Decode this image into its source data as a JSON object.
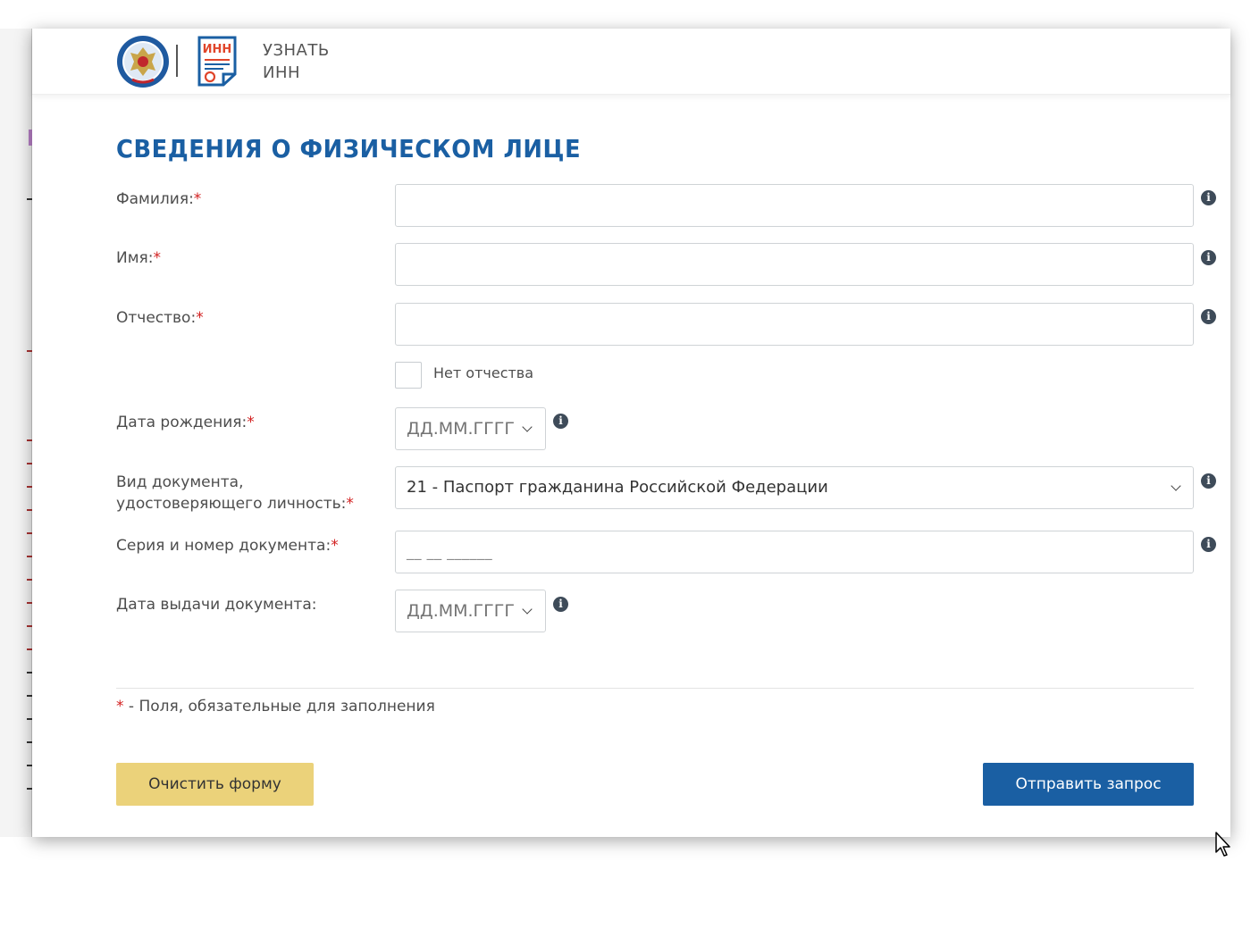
{
  "header": {
    "title_line1": "УЗНАТЬ",
    "title_line2": "ИНН",
    "inn_logo_text": "ИНН",
    "emblem_icon": "fns-emblem-icon",
    "inn_icon": "inn-document-icon"
  },
  "form": {
    "title": "СВЕДЕНИЯ О ФИЗИЧЕСКОМ ЛИЦЕ",
    "required_mark": "*",
    "surname_label": "Фамилия:",
    "surname_value": "",
    "name_label": "Имя:",
    "name_value": "",
    "patronymic_label": "Отчество:",
    "patronymic_value": "",
    "no_patronymic_label": "Нет отчества",
    "no_patronymic_checked": false,
    "birthdate_label": "Дата рождения:",
    "birthdate_placeholder": "ДД.ММ.ГГГГ",
    "doc_type_label_line1": "Вид документа,",
    "doc_type_label_line2": "удостоверяющего личность:",
    "doc_type_value": "21 - Паспорт гражданина Российской Федерации",
    "doc_number_label": "Серия и номер документа:",
    "doc_number_mask": "__ __ ______",
    "issue_date_label": "Дата выдачи документа:",
    "issue_date_placeholder": "ДД.ММ.ГГГГ",
    "info_icon_glyph": "i",
    "footnote_mark": "*",
    "footnote_text": " - Поля, обязательные для заполнения"
  },
  "buttons": {
    "clear_label": "Очистить форму",
    "submit_label": "Отправить запрос"
  },
  "colors": {
    "title_blue": "#1a5fa3",
    "required_red": "#d21f1f",
    "clear_button": "#ebd27a",
    "submit_button": "#1a5fa3"
  }
}
